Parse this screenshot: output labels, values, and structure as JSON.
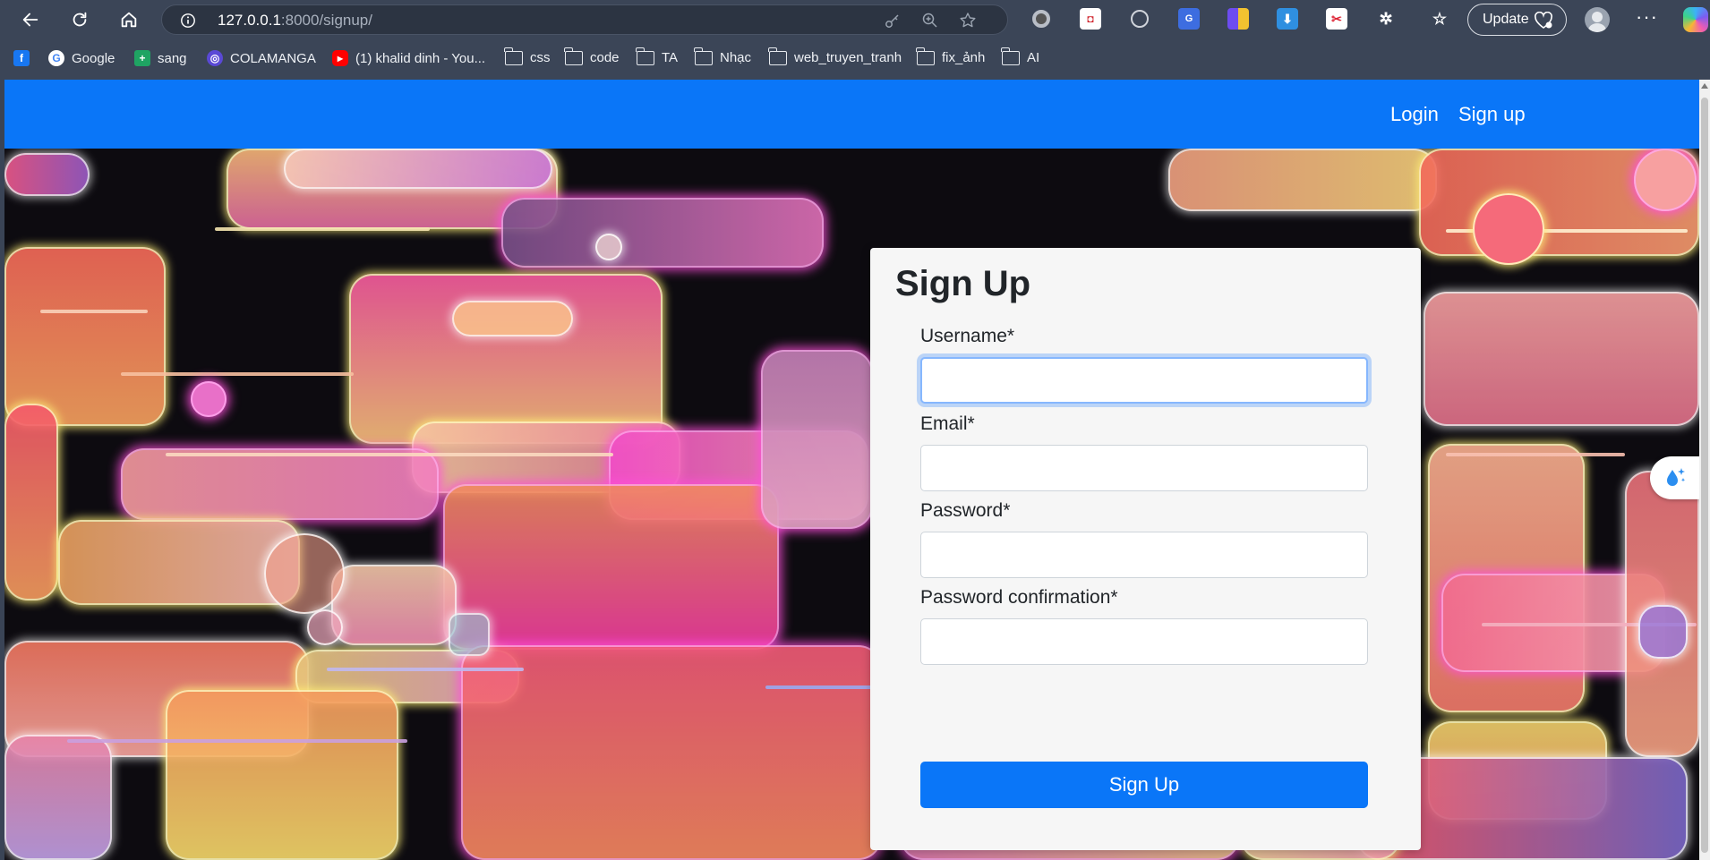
{
  "browser": {
    "url_host": "127.0.0.1",
    "url_rest": ":8000/signup/",
    "update_label": "Update",
    "more_label": "···",
    "bookmarks": [
      {
        "label": "",
        "icon": "facebook-icon"
      },
      {
        "label": "Google",
        "icon": "google-icon"
      },
      {
        "label": "sang",
        "icon": "sheets-icon"
      },
      {
        "label": "COLAMANGA",
        "icon": "colamanga-icon"
      },
      {
        "label": "(1) khalid dinh - You...",
        "icon": "youtube-icon"
      },
      {
        "label": "css",
        "icon": "folder-icon"
      },
      {
        "label": "code",
        "icon": "folder-icon"
      },
      {
        "label": "TA",
        "icon": "folder-icon"
      },
      {
        "label": "Nhạc",
        "icon": "folder-icon"
      },
      {
        "label": "web_truyen_tranh",
        "icon": "folder-icon"
      },
      {
        "label": "fix_ảnh",
        "icon": "folder-icon"
      },
      {
        "label": "AI",
        "icon": "folder-icon"
      }
    ]
  },
  "navbar": {
    "login_label": "Login",
    "signup_label": "Sign up"
  },
  "form": {
    "title": "Sign Up",
    "fields": [
      {
        "label": "Username*",
        "value": ""
      },
      {
        "label": "Email*",
        "value": ""
      },
      {
        "label": "Password*",
        "value": ""
      },
      {
        "label": "Password confirmation*",
        "value": ""
      }
    ],
    "submit_label": "Sign Up"
  },
  "colors": {
    "primary": "#0a76f8",
    "card_bg": "#f6f6f6",
    "chrome_bg": "#3b4557"
  }
}
